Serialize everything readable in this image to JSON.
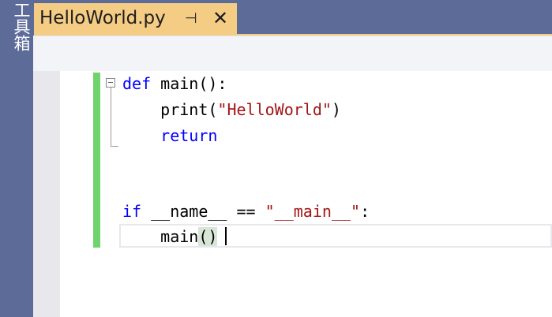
{
  "toolbox": {
    "label": "工具箱"
  },
  "tab": {
    "title": "HelloWorld.py",
    "pin_glyph": "⊣",
    "close_glyph": "✕"
  },
  "code": {
    "lines": [
      {
        "kw": "def",
        "rest": " main():"
      },
      {
        "pre": "    print(",
        "str": "\"HelloWorld\"",
        "post": ")"
      },
      {
        "kw": "return",
        "indent": "    "
      },
      {
        "text": ""
      },
      {
        "text": ""
      },
      {
        "kw": "if",
        "rest": " __name__ == ",
        "str": "\"__main__\"",
        "post": ":"
      },
      {
        "pre": "    main",
        "paren": "()"
      }
    ]
  },
  "colors": {
    "toolbox_bg": "#5d6b99",
    "tab_active": "#f5cc84",
    "change_bar": "#6fd36f",
    "keyword": "#0000ff",
    "string": "#a31515"
  }
}
